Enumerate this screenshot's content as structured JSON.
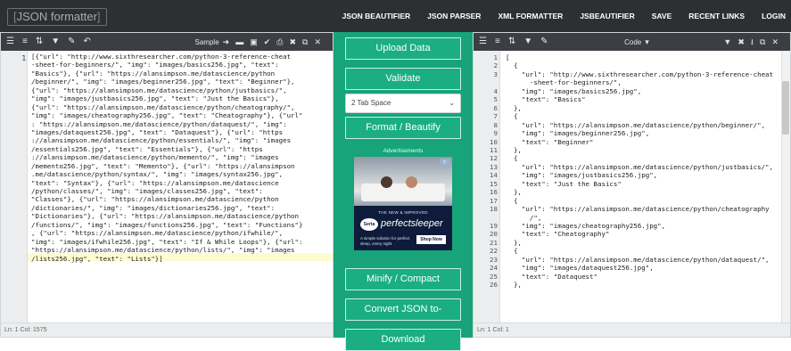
{
  "app": {
    "logo": "JSON formatter",
    "nav": [
      "JSON BEAUTIFIER",
      "JSON PARSER",
      "XML FORMATTER",
      "JSBEAUTIFIER",
      "SAVE",
      "RECENT LINKS",
      "LOGIN"
    ]
  },
  "left_editor": {
    "toolbar_sample_label": "Sample",
    "status": "Ln: 1   Col: 1575",
    "line_number": "1",
    "code_lines": [
      "[{\"url\": \"http://www.sixthresearcher.com/python-3-reference-cheat",
      "-sheet-for-beginners/\", \"img\": \"images/basics256.jpg\", \"text\":",
      "\"Basics\"}, {\"url\": \"https://alansimpson.me/datascience/python",
      "/beginner/\", \"img\": \"images/beginner256.jpg\", \"text\": \"Beginner\"},",
      "{\"url\": \"https://alansimpson.me/datascience/python/justbasics/\",",
      "\"img\": \"images/justbasics256.jpg\", \"text\": \"Just the Basics\"},",
      "{\"url\": \"https://alansimpson.me/datascience/python/cheatography/\",",
      "\"img\": \"images/cheatography256.jpg\", \"text\": \"Cheatography\"}, {\"url\"",
      ": \"https://alansimpson.me/datascience/python/dataquest/\", \"img\":",
      "\"images/dataquest256.jpg\", \"text\": \"Dataquest\"}, {\"url\": \"https",
      "://alansimpson.me/datascience/python/essentials/\", \"img\": \"images",
      "/essentials256.jpg\", \"text\": \"Essentials\"}, {\"url\": \"https",
      "://alansimpson.me/datascience/python/memento/\", \"img\": \"images",
      "/memento256.jpg\", \"text\": \"Memento\"}, {\"url\": \"https://alansimpson",
      ".me/datascience/python/syntax/\", \"img\": \"images/syntax256.jpg\",",
      "\"text\": \"Syntax\"}, {\"url\": \"https://alansimpson.me/datascience",
      "/python/classes/\", \"img\": \"images/classes256.jpg\", \"text\":",
      "\"Classes\"}, {\"url\": \"https://alansimpson.me/datascience/python",
      "/dictionaries/\", \"img\": \"images/dictionaries256.jpg\", \"text\":",
      "\"Dictionaries\"}, {\"url\": \"https://alansimpson.me/datascience/python",
      "/functions/\", \"img\": \"images/functions256.jpg\", \"text\": \"Functions\"}",
      ", {\"url\": \"https://alansimpson.me/datascience/python/ifwhile/\",",
      "\"img\": \"images/ifwhile256.jpg\", \"text\": \"If & While Loops\"}, {\"url\":",
      "\"https://alansimpson.me/datascience/python/lists/\", \"img\": \"images",
      "/lists256.jpg\", \"text\": \"Lists\"}]"
    ]
  },
  "middle": {
    "upload_label": "Upload Data",
    "validate_label": "Validate",
    "indent_select": "2 Tab Space",
    "format_label": "Format / Beautify",
    "ad_label": "Advertisements",
    "ad_top_text": "THE NEW & IMPROVED",
    "ad_logo_text": "Serta",
    "ad_brand": "perfectsleeper",
    "ad_body": "A simple solution for perfect sleep, every night",
    "ad_button": "Shop Now",
    "minify_label": "Minify / Compact",
    "convert_label": "Convert JSON to-",
    "download_label": "Download"
  },
  "right_editor": {
    "toolbar_code_label": "Code",
    "status": "Ln: 1   Col: 1",
    "rows": [
      {
        "n": "1",
        "t": "["
      },
      {
        "n": "2",
        "t": "  {"
      },
      {
        "n": "3",
        "t": "    \"url\": \"http://www.sixthresearcher.com/python-3-reference-cheat"
      },
      {
        "n": "",
        "t": "      -sheet-for-beginners/\","
      },
      {
        "n": "4",
        "t": "    \"img\": \"images/basics256.jpg\","
      },
      {
        "n": "5",
        "t": "    \"text\": \"Basics\""
      },
      {
        "n": "6",
        "t": "  },"
      },
      {
        "n": "7",
        "t": "  {"
      },
      {
        "n": "8",
        "t": "    \"url\": \"https://alansimpson.me/datascience/python/beginner/\","
      },
      {
        "n": "9",
        "t": "    \"img\": \"images/beginner256.jpg\","
      },
      {
        "n": "10",
        "t": "    \"text\": \"Beginner\""
      },
      {
        "n": "11",
        "t": "  },"
      },
      {
        "n": "12",
        "t": "  {"
      },
      {
        "n": "13",
        "t": "    \"url\": \"https://alansimpson.me/datascience/python/justbasics/\","
      },
      {
        "n": "14",
        "t": "    \"img\": \"images/justbasics256.jpg\","
      },
      {
        "n": "15",
        "t": "    \"text\": \"Just the Basics\""
      },
      {
        "n": "16",
        "t": "  },"
      },
      {
        "n": "17",
        "t": "  {"
      },
      {
        "n": "18",
        "t": "    \"url\": \"https://alansimpson.me/datascience/python/cheatography"
      },
      {
        "n": "",
        "t": "      /\","
      },
      {
        "n": "19",
        "t": "    \"img\": \"images/cheatography256.jpg\","
      },
      {
        "n": "20",
        "t": "    \"text\": \"Cheatography\""
      },
      {
        "n": "21",
        "t": "  },"
      },
      {
        "n": "22",
        "t": "  {"
      },
      {
        "n": "23",
        "t": "    \"url\": \"https://alansimpson.me/datascience/python/dataquest/\","
      },
      {
        "n": "24",
        "t": "    \"img\": \"images/dataquest256.jpg\","
      },
      {
        "n": "25",
        "t": "    \"text\": \"Dataquest\""
      },
      {
        "n": "26",
        "t": "  },"
      }
    ]
  }
}
